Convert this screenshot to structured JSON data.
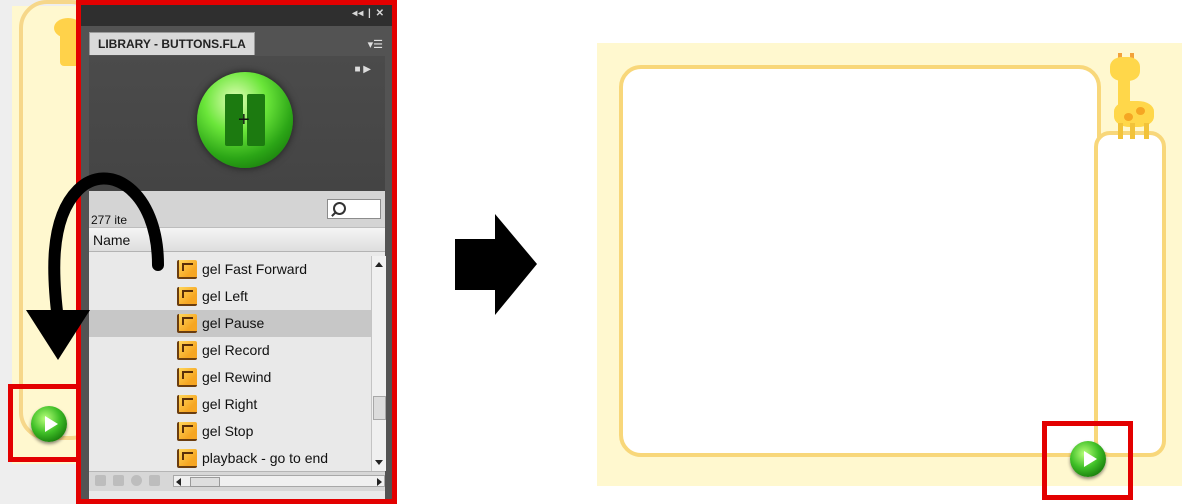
{
  "library": {
    "title": "LIBRARY - BUTTONS.FLA",
    "item_count": "277 ite",
    "column_name": "Name",
    "items": [
      {
        "label": "gel Fast Forward",
        "selected": false
      },
      {
        "label": "gel Left",
        "selected": false
      },
      {
        "label": "gel Pause",
        "selected": true
      },
      {
        "label": "gel Record",
        "selected": false
      },
      {
        "label": "gel Rewind",
        "selected": false
      },
      {
        "label": "gel Right",
        "selected": false
      },
      {
        "label": "gel Stop",
        "selected": false
      },
      {
        "label": "playback - go to end",
        "selected": false
      }
    ]
  },
  "colors": {
    "highlight": "#e30000",
    "panel_dark": "#535353",
    "stage_bg": "#fff8cf",
    "frame_border": "#f8d77a",
    "button_green": "#3fbf27"
  },
  "icons": {
    "button_symbol": "button-symbol-icon",
    "search": "search-icon",
    "play": "play-icon",
    "pause": "pause-icon"
  }
}
